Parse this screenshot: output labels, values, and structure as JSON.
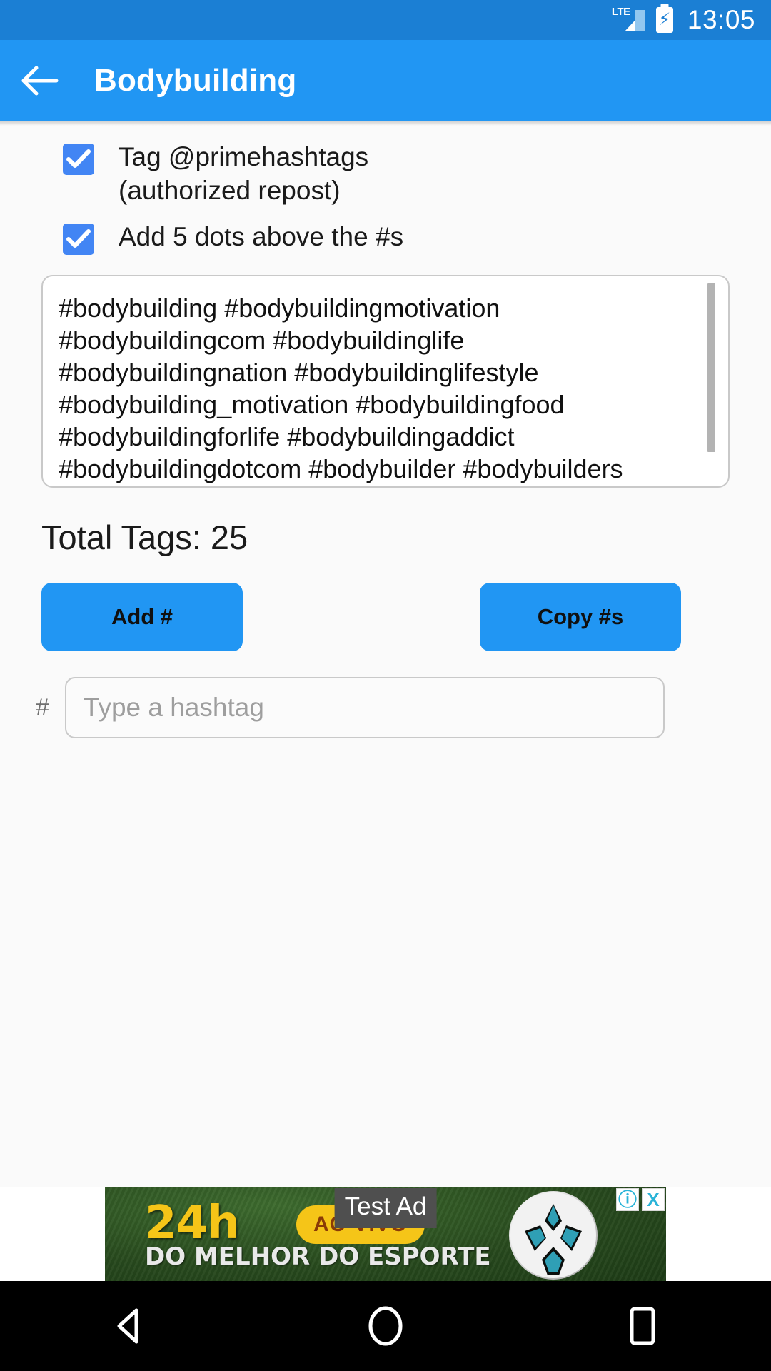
{
  "statusbar": {
    "network_label": "LTE",
    "time": "13:05",
    "battery_icon": "battery-charging-icon",
    "signal_icon": "signal-bars-icon"
  },
  "appbar": {
    "back_icon": "back-arrow-icon",
    "title": "Bodybuilding",
    "background": "#2196f3"
  },
  "options": {
    "checkbox_color": "#4285f4",
    "items": [
      {
        "label": "Tag @primehashtags\n(authorized repost)",
        "checked": true
      },
      {
        "label": "Add 5 dots above the #s",
        "checked": true
      }
    ]
  },
  "hashtag_box": {
    "text": "#bodybuilding #bodybuildingmotivation\n#bodybuildingcom #bodybuildinglife\n#bodybuildingnation #bodybuildinglifestyle\n#bodybuilding_motivation #bodybuildingfood\n#bodybuildingforlife #bodybuildingaddict\n#bodybuildingdotcom #bodybuilder #bodybuilders\n#muscle #muscles #muscleup #musclegain\n#musclebuilding #physique #shredded #pump"
  },
  "total_tags_label": "Total Tags: 25",
  "buttons": {
    "add": "Add #",
    "copy": "Copy #s",
    "color": "#2196f3"
  },
  "hashtag_input": {
    "prefix": "#",
    "value": "",
    "placeholder": "Type a hashtag"
  },
  "ad": {
    "headline": "24h",
    "pill": "AO VIVO",
    "subline": "DO MELHOR DO ESPORTE",
    "test_badge": "Test Ad",
    "info_icon": "info-icon",
    "close_icon": "close-icon",
    "info_glyph": "ⓘ",
    "close_glyph": "X",
    "ball_icon": "soccer-ball-icon"
  },
  "navbar": {
    "back_icon": "nav-back-triangle-icon",
    "home_icon": "nav-home-circle-icon",
    "recents_icon": "nav-recents-square-icon"
  }
}
